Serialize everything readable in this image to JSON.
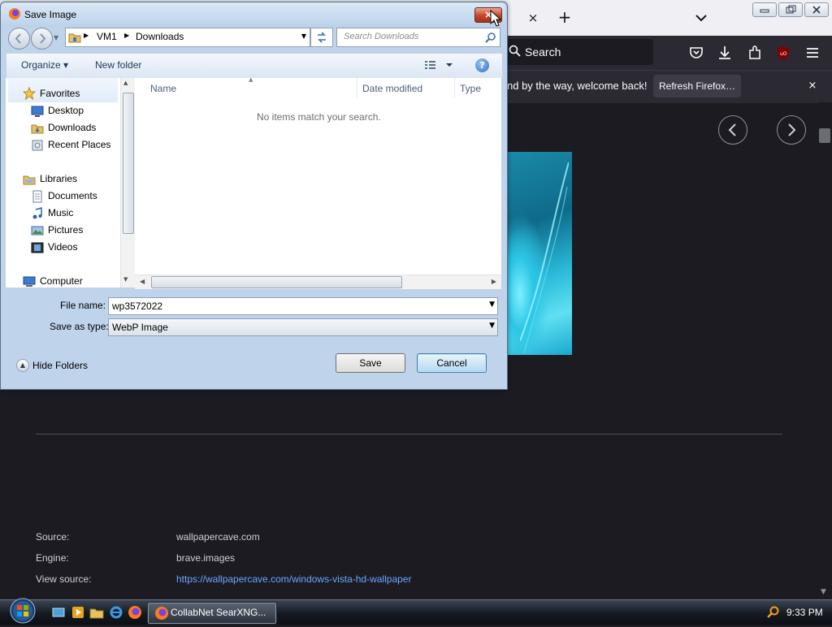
{
  "browser": {
    "tab_close": "×",
    "new_tab": "+",
    "search_placeholder": "Search",
    "notification": {
      "text": "nd by the way, welcome back!",
      "button": "Refresh Firefox…",
      "close": "×"
    },
    "nav_prev": "‹",
    "nav_next": "›",
    "info": {
      "source_label": "Source:",
      "source_value": "wallpapercave.com",
      "engine_label": "Engine:",
      "engine_value": "brave.images",
      "view_source_label": "View source:",
      "view_source_value": "https://wallpapercave.com/windows-vista-hd-wallpaper"
    },
    "icons": [
      "pocket-icon",
      "download-icon",
      "extensions-icon",
      "ublock-icon",
      "menu-icon"
    ]
  },
  "dialog": {
    "title": "Save Image",
    "close_label": "×",
    "breadcrumb": [
      "VM1",
      "Downloads"
    ],
    "search_placeholder": "Search Downloads",
    "toolbar": {
      "organize": "Organize ▾",
      "new_folder": "New folder"
    },
    "nav_pane": {
      "favorites": "Favorites",
      "favorites_items": [
        "Desktop",
        "Downloads",
        "Recent Places"
      ],
      "libraries": "Libraries",
      "libraries_items": [
        "Documents",
        "Music",
        "Pictures",
        "Videos"
      ],
      "computer": "Computer"
    },
    "columns": {
      "name": "Name",
      "date_modified": "Date modified",
      "type": "Type"
    },
    "empty_message": "No items match your search.",
    "file_name_label": "File name:",
    "file_name_value": "wp3572022",
    "save_type_label": "Save as type:",
    "save_type_value": "WebP Image",
    "hide_folders": "Hide Folders",
    "save_button": "Save",
    "cancel_button": "Cancel"
  },
  "taskbar": {
    "task_label": "CollabNet SearXNG...",
    "clock": "9:33 PM"
  }
}
